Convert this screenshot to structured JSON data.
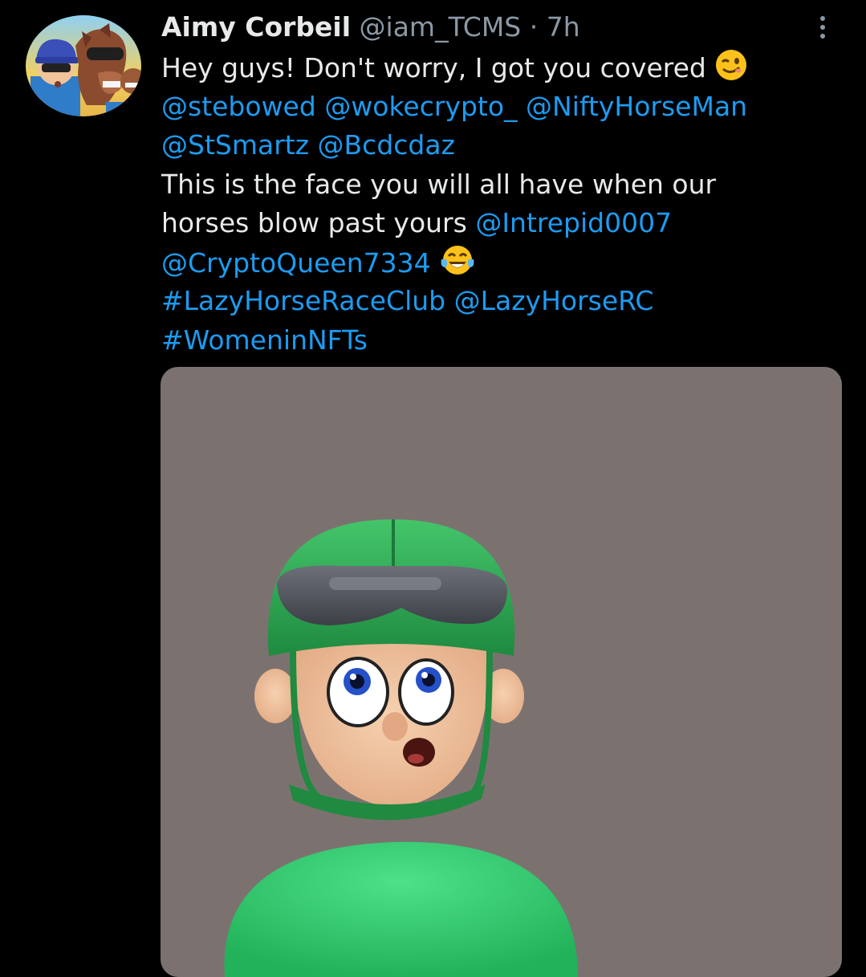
{
  "tweet": {
    "author": {
      "display_name": "Aimy Corbeil",
      "handle": "@iam_TCMS",
      "separator": "·",
      "time": "7h"
    },
    "more_icon": "more-vertical-icon",
    "text_lines": [
      [
        {
          "text": "Hey guys! Don't worry, I got you covered ",
          "kind": "plain"
        },
        {
          "emoji": "winking-face-emoji"
        }
      ],
      [
        {
          "text": "@stebowed",
          "kind": "link"
        },
        {
          "text": " ",
          "kind": "plain"
        },
        {
          "text": "@wokecrypto_",
          "kind": "link"
        },
        {
          "text": " ",
          "kind": "plain"
        },
        {
          "text": "@NiftyHorseMan",
          "kind": "link"
        }
      ],
      [
        {
          "text": "@StSmartz",
          "kind": "link"
        },
        {
          "text": " ",
          "kind": "plain"
        },
        {
          "text": "@Bcdcdaz",
          "kind": "link"
        }
      ],
      [
        {
          "text": "This is the face you will all have when our",
          "kind": "plain"
        }
      ],
      [
        {
          "text": "horses blow past yours ",
          "kind": "plain"
        },
        {
          "text": "@Intrepid0007",
          "kind": "link"
        }
      ],
      [
        {
          "text": "@CryptoQueen7334",
          "kind": "link"
        },
        {
          "text": " ",
          "kind": "plain"
        },
        {
          "emoji": "tears-of-joy-emoji"
        }
      ],
      [
        {
          "text": "#LazyHorseRaceClub",
          "kind": "link"
        },
        {
          "text": " ",
          "kind": "plain"
        },
        {
          "text": "@LazyHorseRC",
          "kind": "link"
        }
      ],
      [
        {
          "text": "#WomeninNFTs",
          "kind": "link"
        }
      ]
    ],
    "media": {
      "subject": "jockey-avatar-image"
    }
  },
  "colors": {
    "background": "#000000",
    "text": "#e7e9ea",
    "secondary": "#8b98a5",
    "link": "#1d9bf0",
    "media_background": "#7b7270",
    "helmet_green": "#2eaa52",
    "shirt_green": "#3fd67a"
  }
}
